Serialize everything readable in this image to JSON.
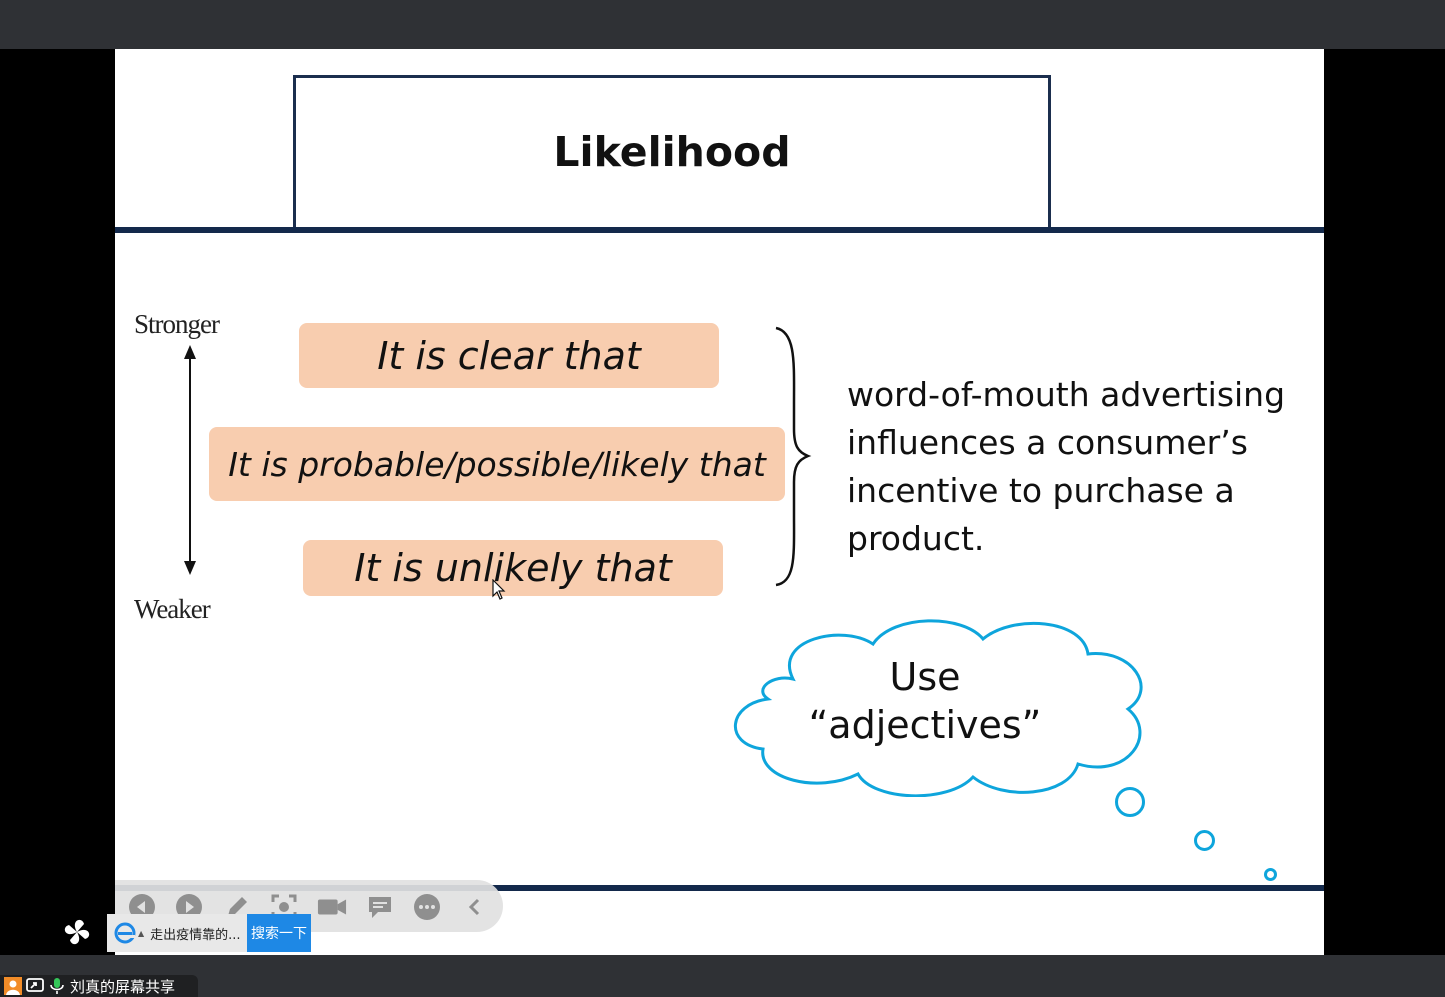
{
  "slide": {
    "title": "Likelihood",
    "scale": {
      "top_label": "Stronger",
      "bottom_label": "Weaker"
    },
    "phrases": [
      "It is clear that",
      "It is probable/possible/likely that",
      "It is unlikely that"
    ],
    "statement": "word-of-mouth advertising influences a consumer’s incentive to purchase a product.",
    "callout": {
      "line1": "Use",
      "line2": "“adjectives”"
    }
  },
  "toolbar": {
    "icons": [
      "prev-icon",
      "play-icon",
      "pen-icon",
      "screenshot-icon",
      "video-icon",
      "comment-icon",
      "more-icon",
      "collapse-icon"
    ]
  },
  "search_widget": {
    "text": "走出疫情靠的...",
    "button_label": "搜索一下"
  },
  "share_status": {
    "label": "刘真的屏幕共享"
  },
  "colors": {
    "phrase_fill": "#f8cdaf",
    "rule": "#13294b",
    "cloud_stroke": "#0ea5dc",
    "search_button": "#1e88e5"
  }
}
